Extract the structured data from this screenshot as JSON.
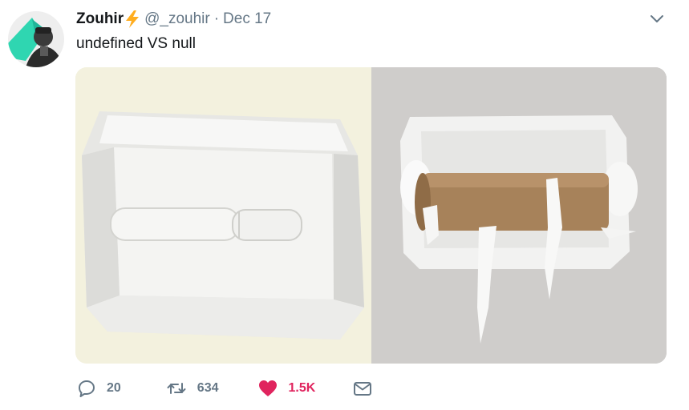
{
  "tweet": {
    "author_name": "Zouhir",
    "handle": "@_zouhir",
    "separator": "·",
    "date": "Dec 17",
    "text": "undefined VS null"
  },
  "icons": {
    "verified_badge": "lightning-bolt",
    "menu": "chevron-down-icon",
    "reply": "speech-bubble-icon",
    "retweet": "retweet-arrows-icon",
    "like": "heart-icon",
    "dm": "envelope-icon"
  },
  "media": {
    "image_count": 2
  },
  "actions": {
    "replies": "20",
    "retweets": "634",
    "likes": "1.5K",
    "liked": true
  },
  "colors": {
    "text": "#14171a",
    "secondary": "#657786",
    "like_active": "#e0245e",
    "bolt": "#ffad1f"
  }
}
